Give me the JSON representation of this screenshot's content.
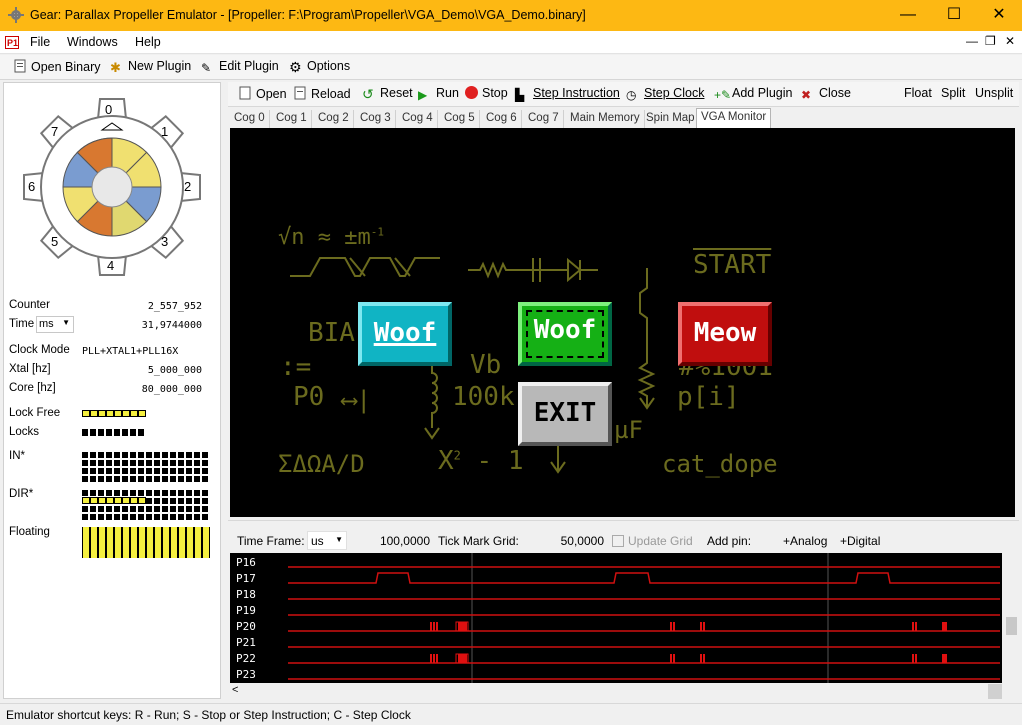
{
  "window": {
    "title": "Gear: Parallax Propeller Emulator - [Propeller: F:\\Program\\Propeller\\VGA_Demo\\VGA_Demo.binary]"
  },
  "menu": [
    "File",
    "Windows",
    "Help"
  ],
  "main_toolbar": {
    "open_binary": "Open Binary",
    "new_plugin": "New Plugin",
    "edit_plugin": "Edit Plugin",
    "options": "Options"
  },
  "gear": {
    "numbers": [
      "0",
      "1",
      "2",
      "3",
      "4",
      "5",
      "6",
      "7"
    ]
  },
  "stats": {
    "counter_label": "Counter",
    "counter_value": "2_557_952",
    "time_label": "Time",
    "time_unit": "ms",
    "time_value": "31,9744000",
    "clock_mode_label": "Clock Mode",
    "clock_mode_value": "PLL+XTAL1+PLL16X",
    "xtal_label": "Xtal [hz]",
    "xtal_value": "5_000_000",
    "core_label": "Core [hz]",
    "core_value": "80_000_000",
    "lock_free_label": "Lock Free",
    "locks_label": "Locks",
    "in_label": "IN*",
    "dir_label": "DIR*",
    "floating_label": "Floating"
  },
  "propeller_toolbar": {
    "open": "Open",
    "reload": "Reload",
    "reset": "Reset",
    "run": "Run",
    "stop": "Stop",
    "step_instruction": "Step Instruction",
    "step_clock": "Step Clock",
    "add_plugin": "Add Plugin",
    "close": "Close",
    "float": "Float",
    "split": "Split",
    "unsplit": "Unsplit"
  },
  "tabs": [
    "Cog 0",
    "Cog 1",
    "Cog 2",
    "Cog 3",
    "Cog 4",
    "Cog 5",
    "Cog 6",
    "Cog 7",
    "Main Memory",
    "Spin Map",
    "VGA Monitor"
  ],
  "active_tab": "VGA Monitor",
  "vga": {
    "formula": "√n ≈ ±m",
    "formula_exp": "-1",
    "start": "START",
    "bia": "BIA",
    "assign": ":=",
    "p0": "P0",
    "vb": "Vb",
    "r100k": "100k",
    "hash": "#%1001",
    "pi": "p[i]",
    "uf": "µF",
    "sigma": "ΣΔΩA/D",
    "x2": "X",
    "x2_exp": "2",
    "x2_tail": "- 1",
    "cat": "cat_dope",
    "btn_woof1": "Woof",
    "btn_woof2": "Woof",
    "btn_meow": "Meow",
    "btn_exit": "EXIT",
    "colors": {
      "olive": "#6b6b1e",
      "cyan": "#0fb3c4",
      "green": "#19b019",
      "red": "#c01010",
      "grey": "#b8b8b8"
    }
  },
  "logic": {
    "time_frame_label": "Time Frame:",
    "time_frame_unit": "us",
    "time_frame_value": "100,0000",
    "tick_label": "Tick Mark Grid:",
    "tick_value": "50,0000",
    "update_grid": "Update Grid",
    "add_pin_label": "Add pin:",
    "add_analog": "+Analog",
    "add_digital": "+Digital",
    "pins": [
      "P16",
      "P17",
      "P18",
      "P19",
      "P20",
      "P21",
      "P22",
      "P23"
    ]
  },
  "status": "Emulator shortcut keys:  R - Run; S - Stop or Step Instruction; C - Step Clock"
}
